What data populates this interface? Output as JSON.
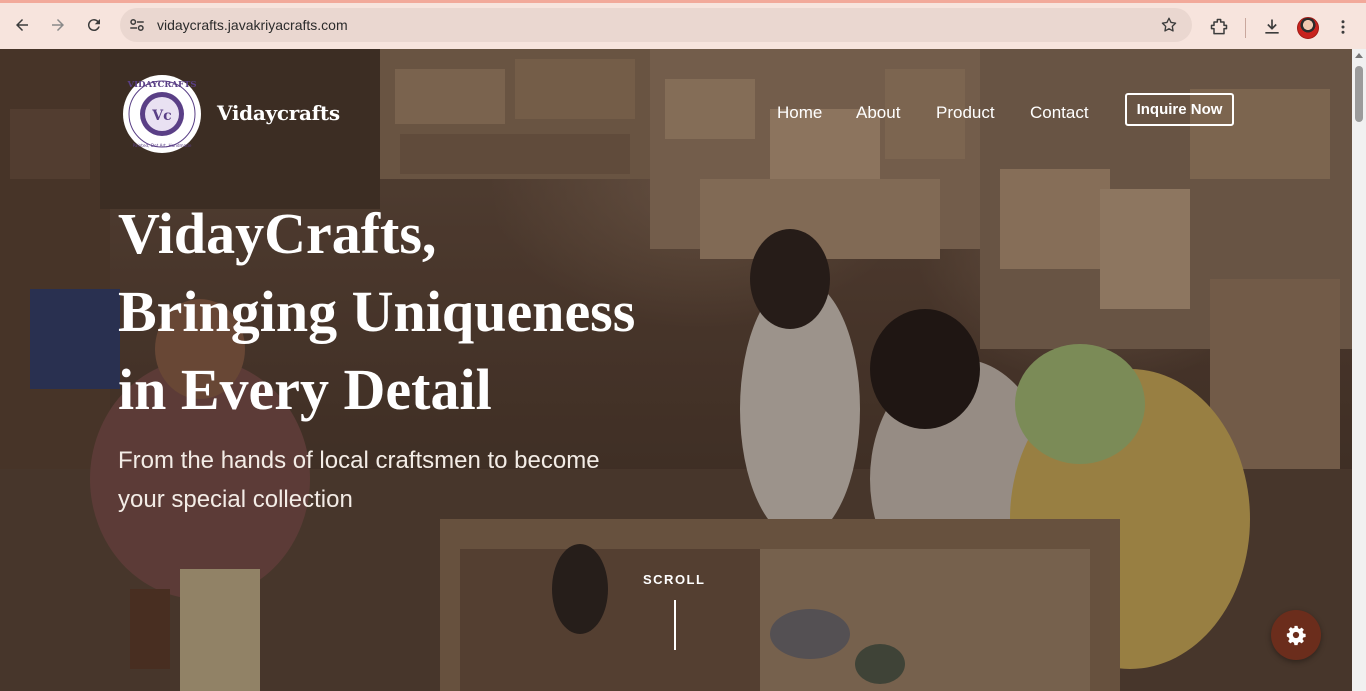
{
  "browser": {
    "url": "vidaycrafts.javakriyacrafts.com",
    "icons": [
      "back-arrow-icon",
      "forward-arrow-icon",
      "reload-icon",
      "site-settings-icon",
      "bookmark-star-icon",
      "extensions-icon",
      "download-icon",
      "profile-avatar",
      "more-menu-icon"
    ]
  },
  "site": {
    "logo": {
      "top_text": "VIDAYCRAFTS",
      "monogram": "Vc",
      "bottom_text": "Painted, Dot Art, Handmade"
    },
    "brand_name": "Vidaycrafts",
    "nav": {
      "home": "Home",
      "about": "About",
      "product": "Product",
      "contact": "Contact",
      "inquire": "Inquire Now"
    }
  },
  "hero": {
    "title_line1": "VidayCrafts,",
    "title_line2": "Bringing Uniqueness",
    "title_line3": "in Every Detail",
    "subtitle_line1": "From the hands of local craftsmen to become",
    "subtitle_line2": "your special collection",
    "scroll_label": "SCROLL"
  },
  "colors": {
    "chrome_bg": "#f7e4dd",
    "omnibox_bg": "#ead7d0",
    "fab_bg": "#6b2d1c",
    "logo_purple": "#5a3f86"
  }
}
